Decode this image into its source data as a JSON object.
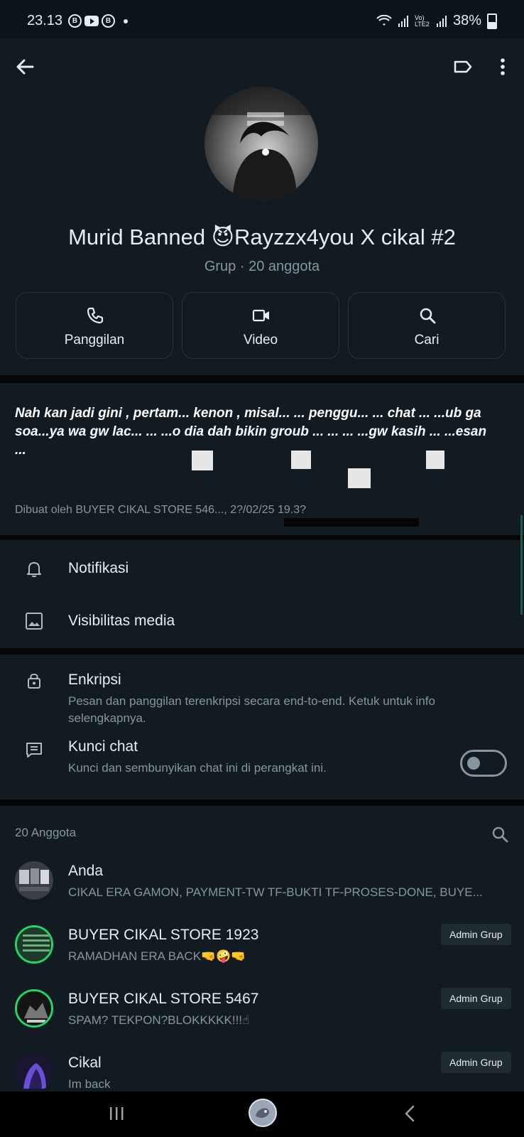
{
  "status_bar": {
    "time": "23.13",
    "notif_b1": "B",
    "notif_b2": "B",
    "network": "Vo) LTE2",
    "battery": "38%"
  },
  "header": {
    "back_icon": "arrow-left-icon",
    "label_icon": "label-icon",
    "menu_icon": "more-vert-icon"
  },
  "group": {
    "title": "Murid Banned 😈Rayzzx4you X cikal #2",
    "subtitle": "Grup · 20 anggota"
  },
  "actions": [
    {
      "label": "Panggilan",
      "icon": "phone-icon"
    },
    {
      "label": "Video",
      "icon": "video-icon"
    },
    {
      "label": "Cari",
      "icon": "search-icon"
    }
  ],
  "description": {
    "text": "Nah kan jadi gini , pertam... kenon , misal... ... penggu... ... chat ... ...ub ga soa...ya wa gw lac... ... ...o dia dah bikin groub ... ... ... ...gw kasih ... ...esan ...",
    "meta": "Dibuat oleh BUYER CIKAL STORE 546..., 2?/02/25 19.3?"
  },
  "settings": {
    "notifikasi": "Notifikasi",
    "visibilitas": "Visibilitas media",
    "enkripsi_title": "Enkripsi",
    "enkripsi_sub": "Pesan dan panggilan terenkripsi secara end-to-end. Ketuk untuk info selengkapnya.",
    "kunci_title": "Kunci chat",
    "kunci_sub": "Kunci dan sembunyikan chat ini di perangkat ini.",
    "kunci_enabled": false
  },
  "members": {
    "count_label": "20 Anggota",
    "list": [
      {
        "name": "Anda",
        "status": "CIKAL ERA GAMON, PAYMENT-TW TF-BUKTI TF-PROSES-DONE, BUYE...",
        "badge": ""
      },
      {
        "name": "BUYER CIKAL STORE 1923",
        "status": "RAMADHAN ERA BACK🤜🤪🤜",
        "badge": "Admin Grup"
      },
      {
        "name": "BUYER CIKAL STORE 5467",
        "status": "SPAM? TEKPON?BLOKKKKK!!!☝",
        "badge": "Admin Grup"
      },
      {
        "name": "Cikal",
        "status": "Im back",
        "badge": "Admin Grup"
      }
    ]
  },
  "colors": {
    "background": "#0b141a",
    "surface": "#111b21",
    "text_primary": "#e9edef",
    "text_secondary": "#8696a0",
    "accent_ring": "#25d366"
  }
}
